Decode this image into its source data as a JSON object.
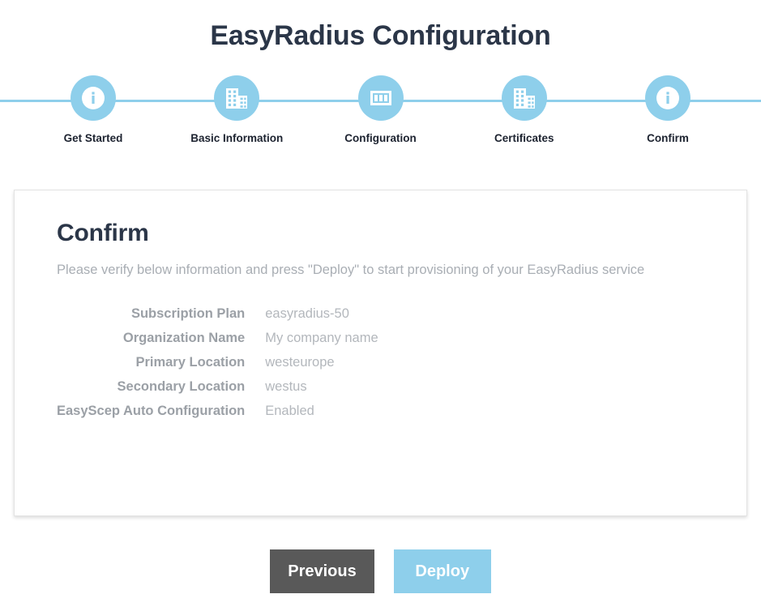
{
  "page": {
    "title": "EasyRadius Configuration",
    "accent_color": "#8ecfeb",
    "title_color": "#2b3648",
    "muted_color": "#a9aeb4"
  },
  "stepper": {
    "steps": [
      {
        "label": "Get Started",
        "icon": "info-icon"
      },
      {
        "label": "Basic Information",
        "icon": "building-icon"
      },
      {
        "label": "Configuration",
        "icon": "server-card-icon"
      },
      {
        "label": "Certificates",
        "icon": "building-icon"
      },
      {
        "label": "Confirm",
        "icon": "info-icon"
      }
    ]
  },
  "card": {
    "title": "Confirm",
    "subtitle": "Please verify below information and press \"Deploy\" to start provisioning of your EasyRadius service",
    "summary": [
      {
        "key": "Subscription Plan",
        "value": "easyradius-50"
      },
      {
        "key": "Organization Name",
        "value": "My company name"
      },
      {
        "key": "Primary Location",
        "value": "westeurope"
      },
      {
        "key": "Secondary Location",
        "value": "westus"
      },
      {
        "key": "EasyScep Auto Configuration",
        "value": "Enabled"
      }
    ]
  },
  "footer": {
    "previous_label": "Previous",
    "deploy_label": "Deploy",
    "previous_color": "#595959",
    "deploy_color": "#8ecfeb"
  }
}
